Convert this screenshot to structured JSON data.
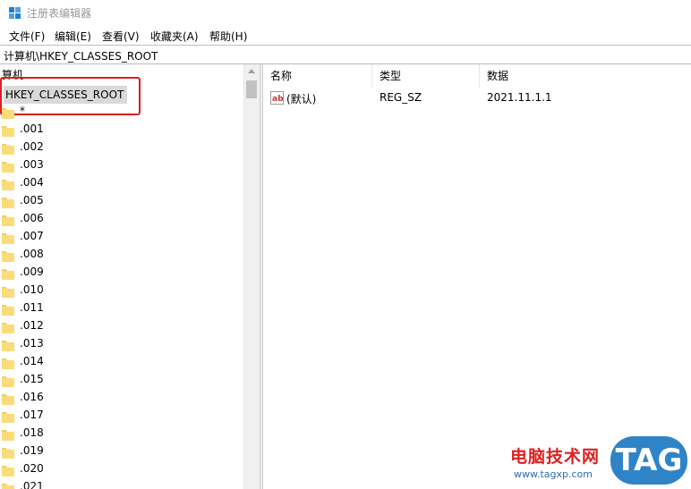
{
  "window": {
    "title": "注册表编辑器"
  },
  "menu": [
    "文件(F)",
    "编辑(E)",
    "查看(V)",
    "收藏夹(A)",
    "帮助(H)"
  ],
  "address": "计算机\\HKEY_CLASSES_ROOT",
  "tree": {
    "root_label": "算机",
    "selected_hive": "HKEY_CLASSES_ROOT",
    "items": [
      "*",
      ".001",
      ".002",
      ".003",
      ".004",
      ".005",
      ".006",
      ".007",
      ".008",
      ".009",
      ".010",
      ".011",
      ".012",
      ".013",
      ".014",
      ".015",
      ".016",
      ".017",
      ".018",
      ".019",
      ".020",
      ".021"
    ]
  },
  "list": {
    "columns": [
      "名称",
      "类型",
      "数据"
    ],
    "rows": [
      {
        "name": "(默认)",
        "type": "REG_SZ",
        "data": "2021.11.1.1",
        "icon": "string-value-icon"
      }
    ]
  },
  "watermark": {
    "text": "电脑技术网",
    "url": "www.tagxp.com",
    "badge": "TAG"
  },
  "colors": {
    "highlight_box": "#e11d1d",
    "folder": "#f6cf5e",
    "selection": "#d9d9d9"
  }
}
